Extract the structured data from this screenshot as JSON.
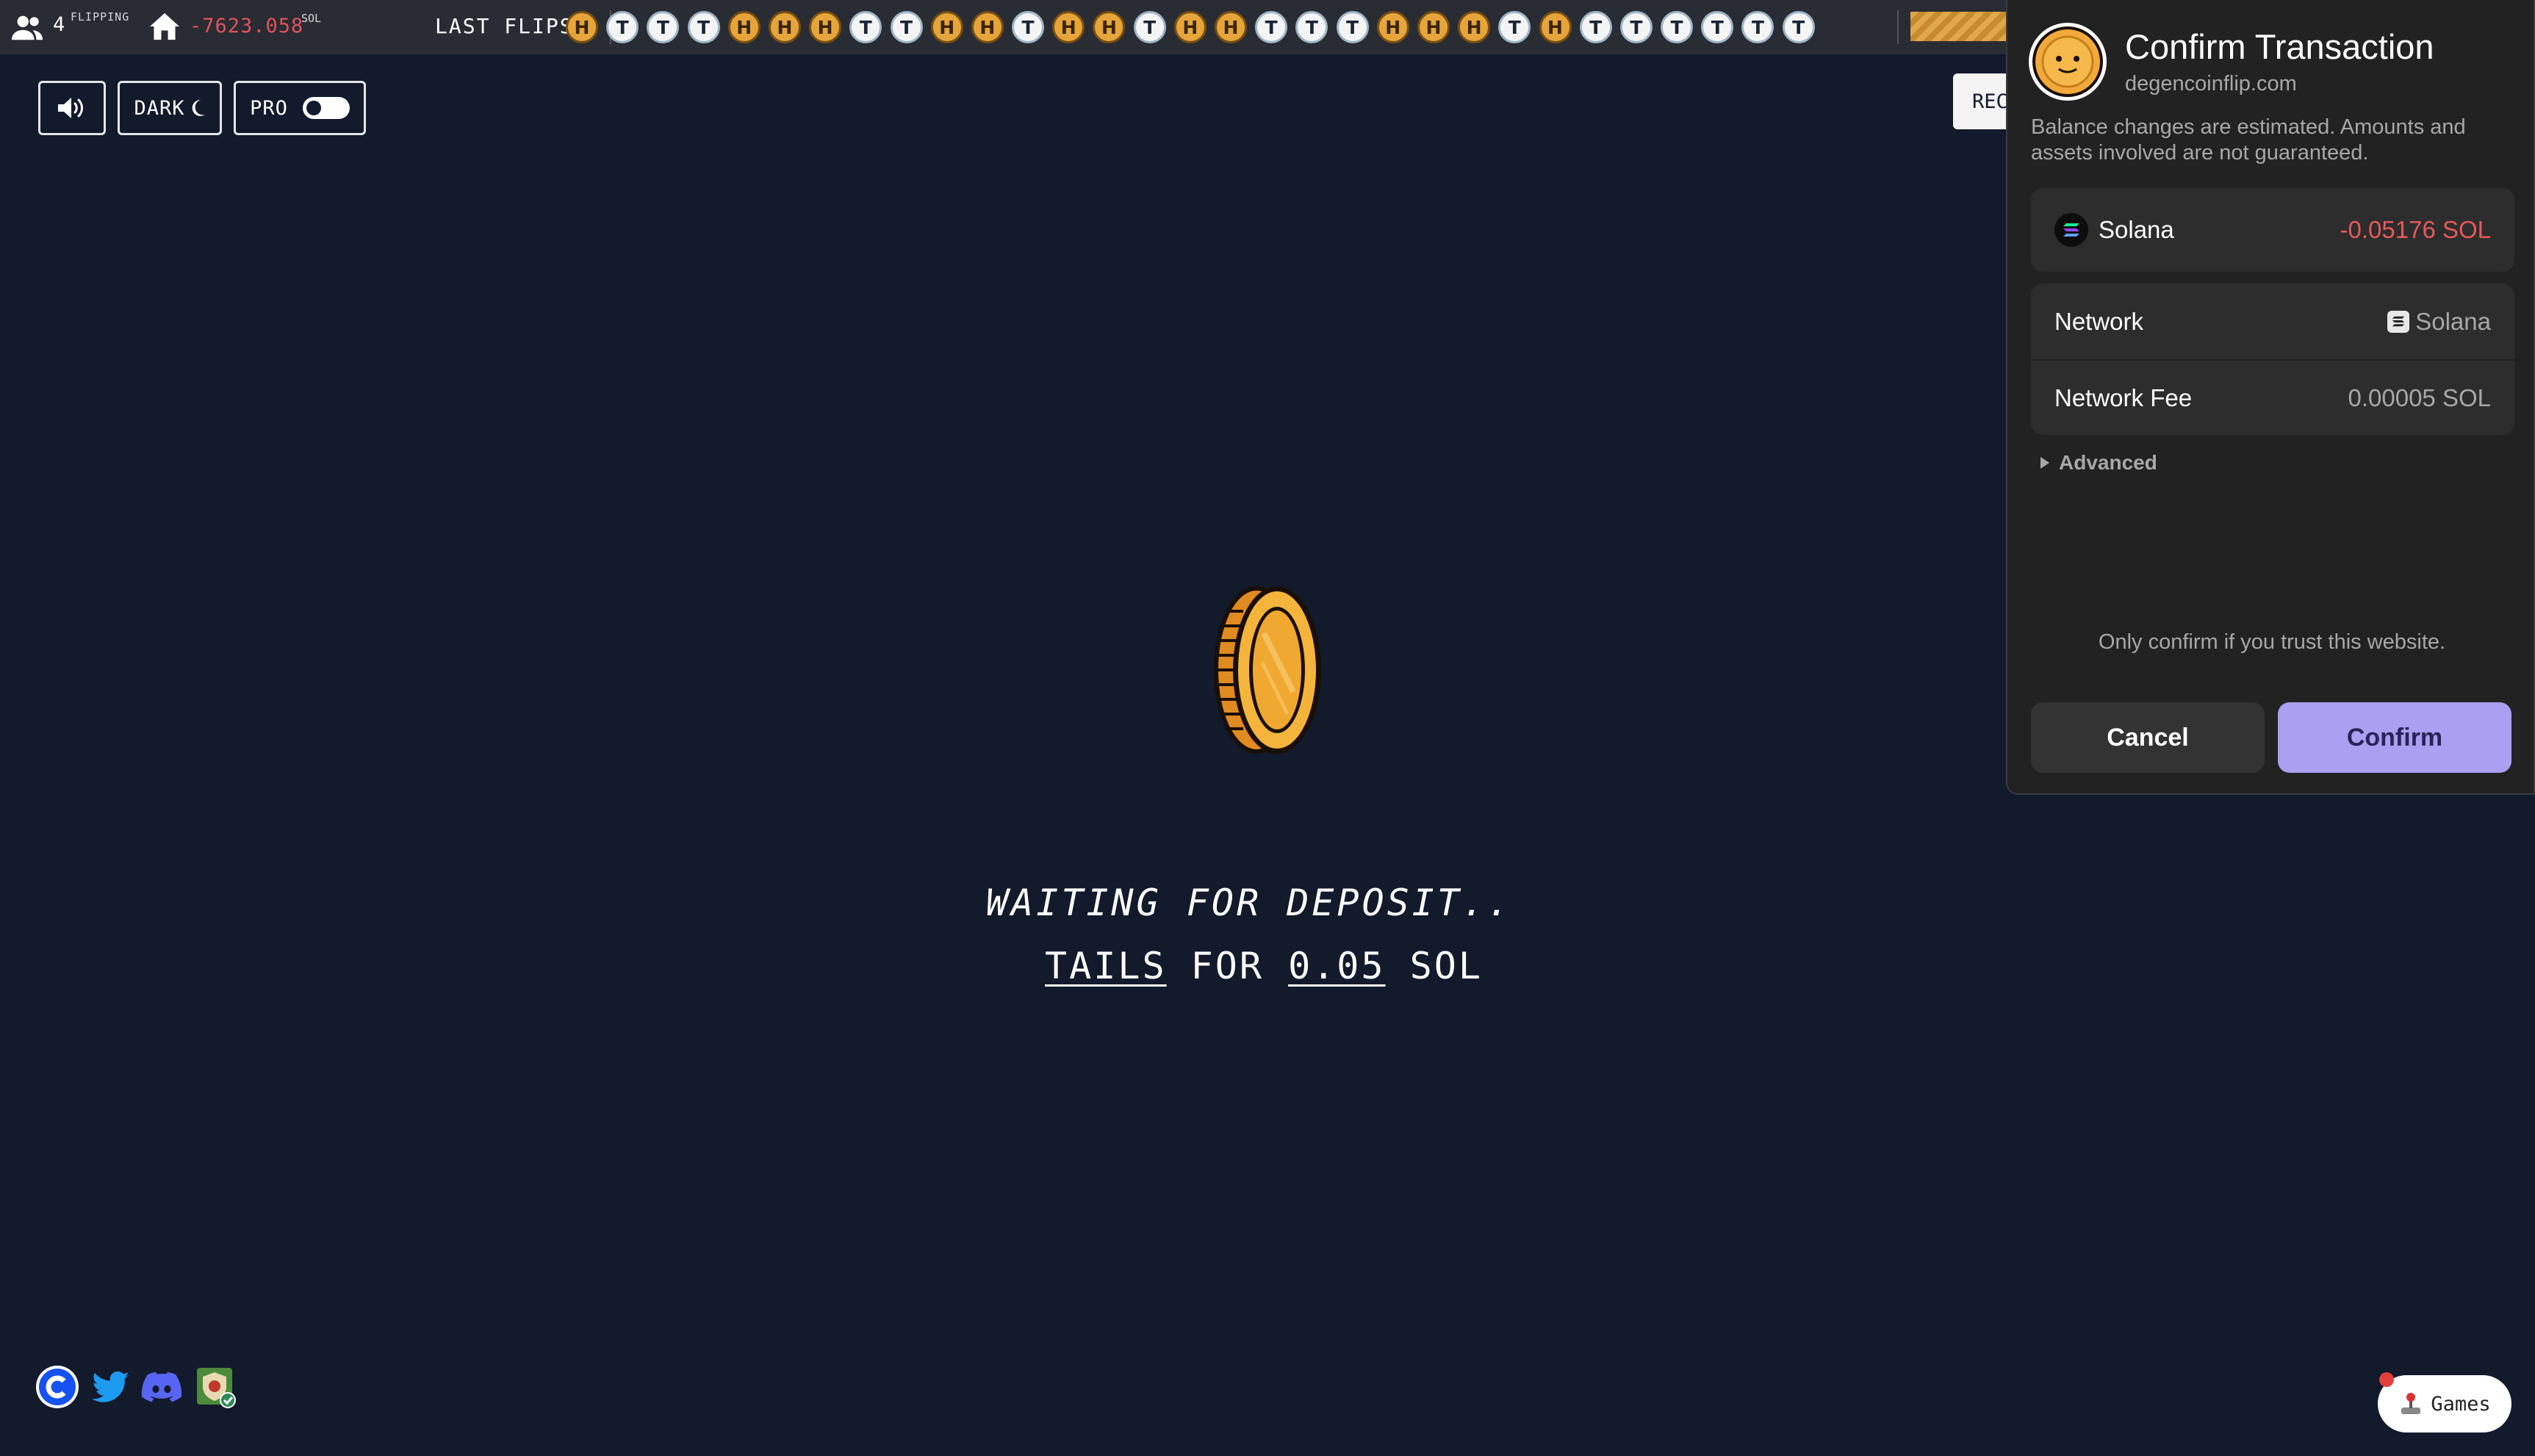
{
  "topbar": {
    "flipping_count": "4",
    "flipping_label": "FLIPPING",
    "balance": "-7623.058",
    "balance_unit": "SOL",
    "last_flips_label": "LAST FLIPS",
    "last_flips": [
      "H",
      "T",
      "T",
      "T",
      "H",
      "H",
      "H",
      "T",
      "T",
      "H",
      "H",
      "T",
      "H",
      "H",
      "T",
      "H",
      "H",
      "T",
      "T",
      "T",
      "H",
      "H",
      "H",
      "T",
      "H",
      "T",
      "T",
      "T",
      "T",
      "T",
      "T"
    ]
  },
  "controls": {
    "sound_icon": "speaker-icon",
    "dark_label": "DARK",
    "dark_icon": "moon-icon",
    "pro_label": "PRO",
    "pro_enabled": false,
    "rec_label": "REC"
  },
  "main": {
    "status": "WAITING FOR DEPOSIT..",
    "side": "TAILS",
    "for_1": "FOR",
    "amount": "0.05",
    "currency": "SOL"
  },
  "footer": {
    "icons": [
      "coinbase-icon",
      "twitter-icon",
      "discord-icon",
      "shield-badge-icon"
    ],
    "games_label": "Games"
  },
  "popup": {
    "title": "Confirm Transaction",
    "domain": "degencoinflip.com",
    "note": "Balance changes are estimated. Amounts and assets involved are not guaranteed.",
    "asset_name": "Solana",
    "asset_change": "-0.05176 SOL",
    "network_label": "Network",
    "network_value": "Solana",
    "fee_label": "Network Fee",
    "fee_value": "0.00005 SOL",
    "advanced_label": "Advanced",
    "trust_note": "Only confirm if you trust this website.",
    "cancel_label": "Cancel",
    "confirm_label": "Confirm"
  },
  "colors": {
    "background": "#131a2c",
    "negative": "#e65a5a",
    "confirm": "#ab9ff2",
    "coin_gold": "#f0a830"
  }
}
